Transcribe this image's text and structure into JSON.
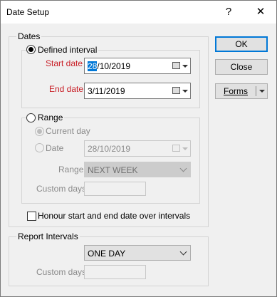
{
  "window": {
    "title": "Date Setup",
    "help_glyph": "?",
    "close_glyph": "✕"
  },
  "dates": {
    "group_label": "Dates",
    "defined_interval": {
      "label": "Defined interval",
      "start_label": "Start date",
      "start_day": "28",
      "start_rest": "/10/2019",
      "end_label": "End date",
      "end_value": "3/11/2019"
    },
    "range": {
      "label": "Range",
      "current_day_label": "Current day",
      "date_label": "Date",
      "date_value": "28/10/2019",
      "range_label": "Range",
      "range_value": "NEXT WEEK",
      "custom_days_label": "Custom days"
    },
    "honour_label": "Honour start and end date over intervals"
  },
  "report": {
    "group_label": "Report Intervals",
    "interval_value": "ONE DAY",
    "custom_days_label": "Custom days"
  },
  "buttons": {
    "ok": "OK",
    "close": "Close",
    "forms": "Forms"
  },
  "colors": {
    "accent": "#0078d7",
    "required_label": "#c81d25"
  }
}
